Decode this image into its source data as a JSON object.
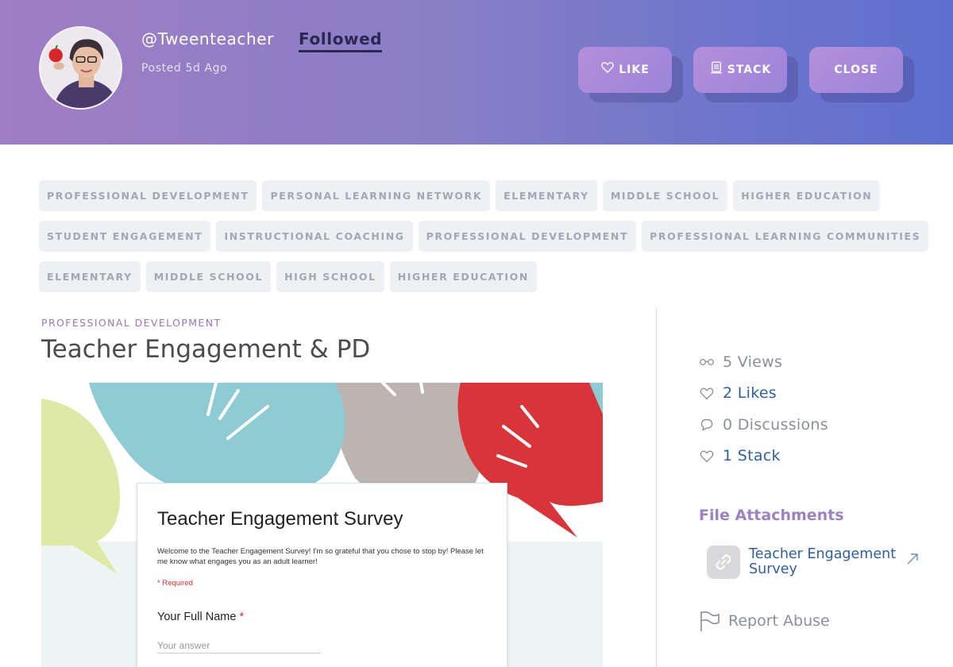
{
  "header": {
    "username": "@Tweenteacher",
    "follow_label": "Followed",
    "posted": "Posted 5d Ago",
    "buttons": {
      "like": "LIKE",
      "stack": "STACK",
      "close": "CLOSE"
    }
  },
  "tags": {
    "rows": [
      [
        "PROFESSIONAL DEVELOPMENT",
        "PERSONAL LEARNING NETWORK",
        "ELEMENTARY",
        "MIDDLE SCHOOL",
        "HIGHER EDUCATION"
      ],
      [
        "STUDENT ENGAGEMENT",
        "INSTRUCTIONAL COACHING",
        "PROFESSIONAL DEVELOPMENT",
        "PROFESSIONAL LEARNING COMMUNITIES"
      ],
      [
        "ELEMENTARY",
        "MIDDLE SCHOOL",
        "HIGH SCHOOL",
        "HIGHER EDUCATION"
      ]
    ]
  },
  "post": {
    "category": "PROFESSIONAL DEVELOPMENT",
    "title": "Teacher Engagement & PD",
    "form": {
      "title": "Teacher Engagement Survey",
      "description": "Welcome to the Teacher Engagement Survey! I'm so grateful that you chose to stop by! Please let me know what engages you as an adult learner!",
      "required_note": "* Required",
      "question": "Your Full Name",
      "required_star": "*",
      "answer_placeholder": "Your answer"
    }
  },
  "sidebar": {
    "views": "5 Views",
    "likes": "2 Likes",
    "discussions": "0 Discussions",
    "stacks": "1 Stack",
    "attachments_heading": "File Attachments",
    "attachment_name": "Teacher Engagement Survey",
    "report": "Report Abuse"
  },
  "colors": {
    "accent_purple": "#9a82c4",
    "link_blue": "#2e5fa6"
  }
}
